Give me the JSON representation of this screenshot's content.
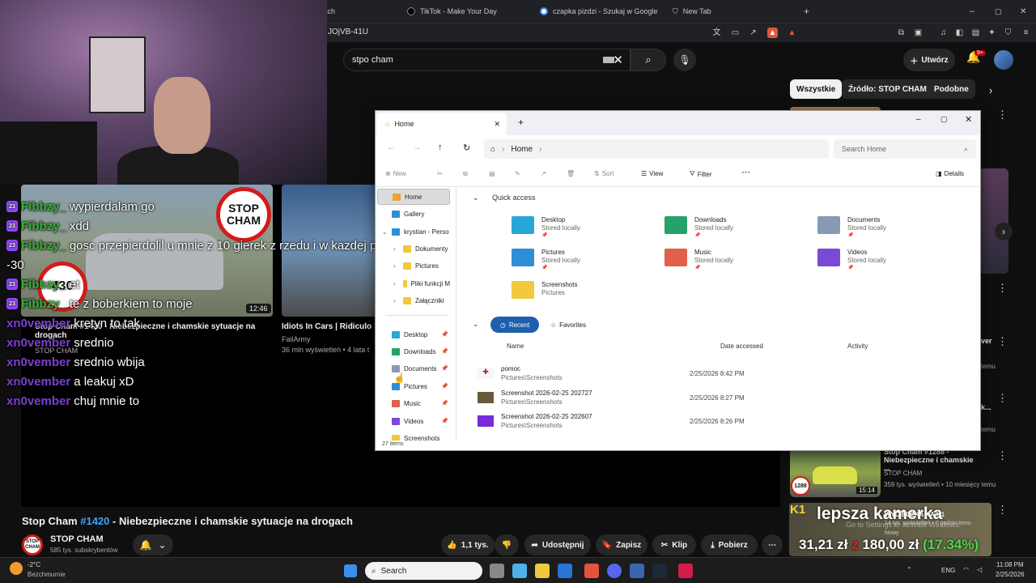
{
  "browser": {
    "tabs": [
      {
        "label": "itch",
        "icon": "tab-icon"
      },
      {
        "label": "TikTok - Make Your Day",
        "icon": "tiktok-icon"
      },
      {
        "label": "czapka pizdzi - Szukaj w Google",
        "icon": "google-icon"
      },
      {
        "label": "New Tab",
        "icon": "shield-icon"
      }
    ],
    "url": "JOjVB-41U",
    "new_tab": "+"
  },
  "youtube": {
    "search_value": "stpo cham",
    "create_label": "Utwórz",
    "notif_count": "9+",
    "chips": [
      "Wszystkie",
      "Źródło: STOP CHAM",
      "Podobne"
    ]
  },
  "thumbs": [
    {
      "title": "Stop Cham #1420 - Niebezpieczne i chamskie sytuacje na drogach",
      "channel": "STOP CHAM",
      "duration": "12:46",
      "sign_top": "STOP\nCHAM",
      "sign_number": "430"
    },
    {
      "title": "Idiots In Cars | Ridiculo",
      "channel": "FailArmy",
      "views": "36 mln wyświetleń • 4 lata t"
    }
  ],
  "chat": [
    {
      "badge": "23",
      "user": "Fibbzy_",
      "msg": "wypierdalam go",
      "color": "green"
    },
    {
      "badge": "23",
      "user": "Fibbzy_",
      "msg": "xdd",
      "color": "green"
    },
    {
      "badge": "23",
      "user": "Fibbzy_",
      "msg": "gosc przepierdolil u mnie z 10 gierek z rzedu i w kazdej po",
      "color": "green"
    },
    {
      "badge": "",
      "user": "",
      "msg": "-30",
      "color": "none"
    },
    {
      "badge": "23",
      "user": "Fibbzy_",
      "msg": "et",
      "color": "green"
    },
    {
      "badge": "23",
      "user": "Fibbzy_",
      "msg": "te z boberkiem to moje",
      "color": "green"
    },
    {
      "badge": "",
      "user": "xn0vember",
      "msg": "kretyn to tak",
      "color": "purple"
    },
    {
      "badge": "",
      "user": "xn0vember",
      "msg": "srednio",
      "color": "purple"
    },
    {
      "badge": "",
      "user": "xn0vember",
      "msg": "srednio wbija",
      "color": "purple"
    },
    {
      "badge": "",
      "user": "xn0vember",
      "msg": "a leakuj xD",
      "color": "purple"
    },
    {
      "badge": "",
      "user": "xn0vember",
      "msg": "chuj mnie to",
      "color": "purple"
    }
  ],
  "video": {
    "title_tag": "Stop Cham ",
    "title_hash": "#1420",
    "title_rest": " - Niebezpieczne i chamskie sytuacje na drogach",
    "channel": "STOP CHAM",
    "subs": "585 tys. subskrybentów",
    "likes": "1,1 tys.",
    "share": "Udostępnij",
    "save": "Zapisz",
    "clip": "Klip",
    "download": "Pobierz",
    "logo_text": "STOP\nCHAM"
  },
  "sidebar_right": [
    {
      "title": "Stop Cham #1288 - Niebezpieczne i chamskie ...",
      "channel": "STOP CHAM",
      "meta": "359 tys. wyświetleń • 10 miesięcy temu",
      "duration": "15:14",
      "badge": "1288"
    },
    {
      "title": "WYCIECZKA NA K1",
      "meta": "14 tys. wyświetleń • 7 godzin temu",
      "tag": "Nowy"
    }
  ],
  "right_fragments": [
    "ver",
    "k...",
    "temu",
    "temu"
  ],
  "banner": {
    "line1": "lepsza kamerka",
    "line2a": "31,21 zł ",
    "line2b": "z ",
    "line2c": "180,00 zł ",
    "line2d": "(17.34%)",
    "watermark": "Go to Settings to activate Windows.",
    "k1": "K1"
  },
  "explorer": {
    "tab_title": "Home",
    "breadcrumb": "Home",
    "search_placeholder": "Search Home",
    "commands": {
      "new": "New",
      "sort": "Sort",
      "view": "View",
      "filter": "Filter",
      "details": "Details"
    },
    "sidebar": [
      {
        "label": "Home",
        "icon": "home-icon"
      },
      {
        "label": "Gallery",
        "icon": "gallery-icon"
      },
      {
        "label": "krystian - Perso",
        "icon": "cloud-icon"
      },
      {
        "label": "Dokumenty",
        "icon": "folder-icon"
      },
      {
        "label": "Pictures",
        "icon": "folder-icon"
      },
      {
        "label": "Pliki funkcji M",
        "icon": "folder-icon"
      },
      {
        "label": "Załączniki",
        "icon": "folder-icon"
      },
      {
        "label": "Desktop",
        "icon": "desktop-icon"
      },
      {
        "label": "Downloads",
        "icon": "downloads-icon"
      },
      {
        "label": "Documents",
        "icon": "documents-icon"
      },
      {
        "label": "Pictures",
        "icon": "pictures-icon"
      },
      {
        "label": "Music",
        "icon": "music-icon"
      },
      {
        "label": "Videos",
        "icon": "videos-icon"
      },
      {
        "label": "Screenshots",
        "icon": "folder-icon"
      }
    ],
    "quick_access_title": "Quick access",
    "quick_access": [
      {
        "name": "Desktop",
        "sub": "Stored locally",
        "color": "#2aa6d6"
      },
      {
        "name": "Downloads",
        "sub": "Stored locally",
        "color": "#27a06a"
      },
      {
        "name": "Documents",
        "sub": "Stored locally",
        "color": "#8899b4"
      },
      {
        "name": "Pictures",
        "sub": "Stored locally",
        "color": "#2f8fd6"
      },
      {
        "name": "Music",
        "sub": "Stored locally",
        "color": "#e0604a"
      },
      {
        "name": "Videos",
        "sub": "Stored locally",
        "color": "#7a4ad6"
      },
      {
        "name": "Screenshots",
        "sub": "Pictures",
        "color": "#f0c93c"
      }
    ],
    "recent_label": "Recent",
    "favorites_label": "Favorites",
    "columns": {
      "name": "Name",
      "date": "Date accessed",
      "activity": "Activity"
    },
    "files": [
      {
        "name": "pomoc",
        "path": "Pictures\\Screenshots",
        "date": "2/25/2026 8:42 PM"
      },
      {
        "name": "Screenshot 2026-02-25 202727",
        "path": "Pictures\\Screenshots",
        "date": "2/25/2026 8:27 PM"
      },
      {
        "name": "Screenshot 2026-02-25 202607",
        "path": "Pictures\\Screenshots",
        "date": "2/25/2026 8:26 PM"
      }
    ],
    "status": "27 items"
  },
  "taskbar": {
    "weather_temp": "-2°C",
    "weather_desc": "Bezchmurnie",
    "search_label": "Search",
    "lang": "ENG",
    "time": "11:08 PM",
    "date": "2/25/2026"
  }
}
